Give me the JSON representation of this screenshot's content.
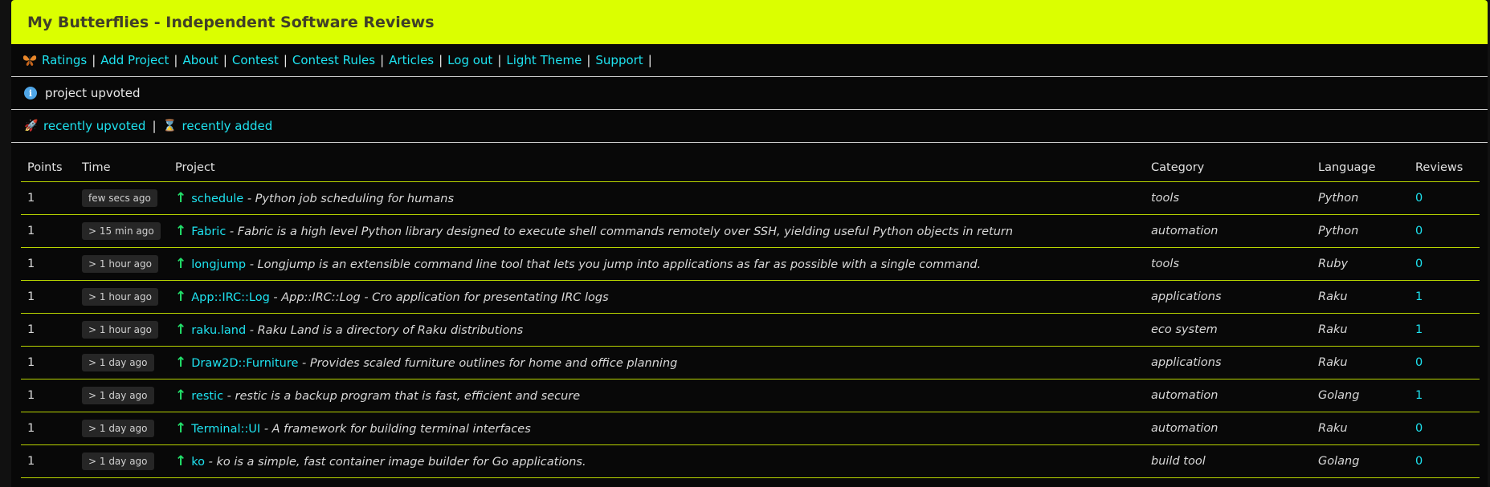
{
  "header": {
    "title": "My Butterflies - Independent Software Reviews"
  },
  "nav": {
    "logo_icon": "butterfly-icon",
    "items": [
      {
        "label": "Ratings"
      },
      {
        "label": "Add Project"
      },
      {
        "label": "About"
      },
      {
        "label": "Contest"
      },
      {
        "label": "Contest Rules"
      },
      {
        "label": "Articles"
      },
      {
        "label": "Log out"
      },
      {
        "label": "Light Theme"
      },
      {
        "label": "Support"
      }
    ],
    "separator": "|"
  },
  "notice": {
    "icon": "info-icon",
    "text": "project upvoted"
  },
  "filters": {
    "recent_upvoted": "recently upvoted",
    "recent_added": "recently added",
    "separator": "|"
  },
  "table": {
    "headers": {
      "points": "Points",
      "time": "Time",
      "project": "Project",
      "category": "Category",
      "language": "Language",
      "reviews": "Reviews"
    },
    "rows": [
      {
        "points": "1",
        "time": "few secs ago",
        "name": "schedule",
        "desc": "- Python job scheduling for humans",
        "category": "tools",
        "language": "Python",
        "reviews": "0"
      },
      {
        "points": "1",
        "time": "> 15 min ago",
        "name": "Fabric",
        "desc": "- Fabric is a high level Python library designed to execute shell commands remotely over SSH, yielding useful Python objects in return",
        "category": "automation",
        "language": "Python",
        "reviews": "0"
      },
      {
        "points": "1",
        "time": "> 1 hour ago",
        "name": "longjump",
        "desc": "- Longjump is an extensible command line tool that lets you jump into applications as far as possible with a single command.",
        "category": "tools",
        "language": "Ruby",
        "reviews": "0"
      },
      {
        "points": "1",
        "time": "> 1 hour ago",
        "name": "App::IRC::Log",
        "desc": "- App::IRC::Log - Cro application for presentating IRC logs",
        "category": "applications",
        "language": "Raku",
        "reviews": "1"
      },
      {
        "points": "1",
        "time": "> 1 hour ago",
        "name": "raku.land",
        "desc": "- Raku Land is a directory of Raku distributions",
        "category": "eco system",
        "language": "Raku",
        "reviews": "1"
      },
      {
        "points": "1",
        "time": "> 1 day ago",
        "name": "Draw2D::Furniture",
        "desc": "- Provides scaled furniture outlines for home and office planning",
        "category": "applications",
        "language": "Raku",
        "reviews": "0"
      },
      {
        "points": "1",
        "time": "> 1 day ago",
        "name": "restic",
        "desc": "- restic is a backup program that is fast, efficient and secure",
        "category": "automation",
        "language": "Golang",
        "reviews": "1"
      },
      {
        "points": "1",
        "time": "> 1 day ago",
        "name": "Terminal::UI",
        "desc": "- A framework for building terminal interfaces",
        "category": "automation",
        "language": "Raku",
        "reviews": "0"
      },
      {
        "points": "1",
        "time": "> 1 day ago",
        "name": "ko",
        "desc": "- ko is a simple, fast container image builder for Go applications.",
        "category": "build tool",
        "language": "Golang",
        "reviews": "0"
      }
    ]
  },
  "colors": {
    "header_bg": "#dbff00",
    "link": "#1ee3f0",
    "upvote": "#22e06a",
    "row_border": "#b8d400"
  }
}
